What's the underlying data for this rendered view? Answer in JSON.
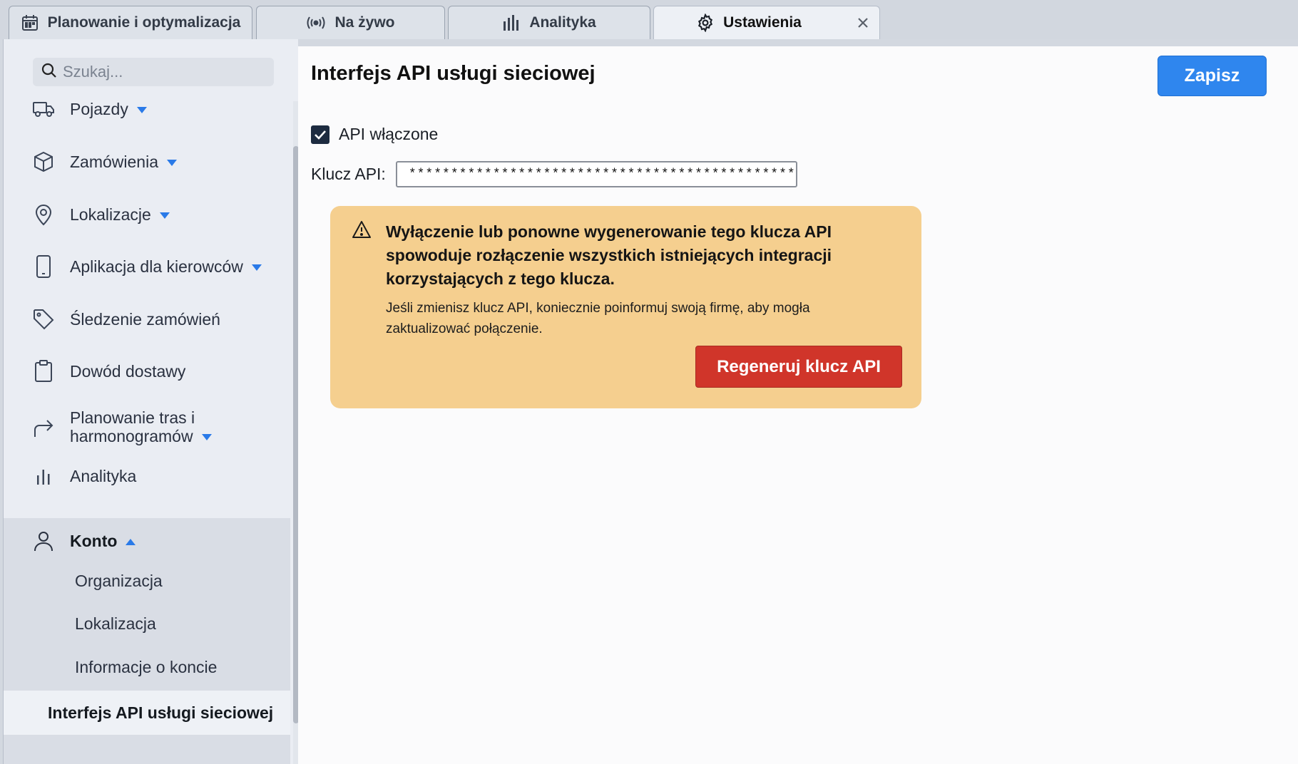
{
  "tabs": [
    {
      "label": "Planowanie i optymalizacja",
      "icon": "calendar-icon"
    },
    {
      "label": "Na żywo",
      "icon": "broadcast-icon"
    },
    {
      "label": "Analityka",
      "icon": "bar-chart-icon"
    },
    {
      "label": "Ustawienia",
      "icon": "gear-icon",
      "active": true
    }
  ],
  "sidebar": {
    "search_placeholder": "Szukaj...",
    "items": [
      {
        "label": "Pojazdy",
        "icon": "truck-icon",
        "expandable": true
      },
      {
        "label": "Zamówienia",
        "icon": "package-icon",
        "expandable": true
      },
      {
        "label": "Lokalizacje",
        "icon": "map-pin-icon",
        "expandable": true
      },
      {
        "label": "Aplikacja dla kierowców",
        "icon": "smartphone-icon",
        "expandable": true
      },
      {
        "label": "Śledzenie zamówień",
        "icon": "tag-icon",
        "expandable": false
      },
      {
        "label": "Dowód dostawy",
        "icon": "clipboard-icon",
        "expandable": false
      },
      {
        "label_line1": "Planowanie tras i",
        "label_line2": "harmonogramów",
        "icon": "route-arrow-icon",
        "expandable": true
      },
      {
        "label": "Analityka",
        "icon": "bar-chart-icon",
        "expandable": false
      },
      {
        "label": "Konto",
        "icon": "user-icon",
        "expanded": true
      }
    ],
    "account_subitems": [
      "Organizacja",
      "Lokalizacja",
      "Informacje o koncie",
      "Interfejs API usługi sieciowej"
    ]
  },
  "main": {
    "title": "Interfejs API usługi sieciowej",
    "save_label": "Zapisz",
    "api_enabled_label": "API włączone",
    "api_enabled": true,
    "api_key_label": "Klucz API:",
    "api_key_value": "***********************************************",
    "warning": {
      "title": "Wyłączenie lub ponowne wygenerowanie tego klucza API spowoduje rozłączenie wszystkich istniejących integracji korzystających z tego klucza.",
      "body": "Jeśli zmienisz klucz API, koniecznie poinformuj swoją firmę, aby mogła zaktualizować połączenie.",
      "button_label": "Regeneruj klucz API"
    }
  },
  "colors": {
    "accent": "#2f86ee",
    "warning_bg": "#f5cf8f",
    "danger": "#d0352a",
    "caret": "#2a7ae8"
  }
}
